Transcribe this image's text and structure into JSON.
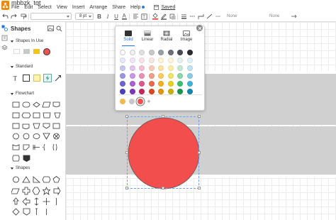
{
  "titlebar": {
    "title": "mbbzk_tgt"
  },
  "menu": {
    "items": [
      "File",
      "Edit",
      "Select",
      "View",
      "Insert",
      "Arrange",
      "Share",
      "Help"
    ],
    "saved_label": "Saved"
  },
  "toolbar": {
    "font_size": "8 pt",
    "line_none_left": "None",
    "line_none_right": "None"
  },
  "sidebar": {
    "header": "Shapes",
    "sections": [
      "Shapes In Use",
      "Standard",
      "Flowchart",
      "Shapes"
    ],
    "in_use_colors": [
      "#ffffff",
      "#c9c9c9",
      "#f0c419",
      "#f05050"
    ]
  },
  "picker": {
    "tabs": [
      "Solid",
      "Linear",
      "Radial",
      "Image"
    ],
    "active_tab": "Solid",
    "palette_rows": [
      [
        "#ffffff",
        "#f2f2f2",
        "#e0e0e0",
        "#c8c8c8",
        "#9aa0a6",
        "#6b7079",
        "#464b55",
        "#2a2d33"
      ],
      [
        "#e8e7f6",
        "#f1e6f5",
        "#f9e2ea",
        "#fbe7e1",
        "#fff4d6",
        "#fcf8d9",
        "#e3f4ea",
        "#e0f1f5"
      ],
      [
        "#c9c6ee",
        "#e3c6ee",
        "#f3c1d4",
        "#f9cbbd",
        "#ffe3a6",
        "#f9f0a3",
        "#c3ead0",
        "#bde4ef"
      ],
      [
        "#9c95e4",
        "#c896e4",
        "#ec8fb4",
        "#f29e87",
        "#ffcb5f",
        "#f3e45f",
        "#88d8a6",
        "#86cde4"
      ],
      [
        "#6d62d6",
        "#a960d4",
        "#e0568d",
        "#ea6a4a",
        "#f5b020",
        "#e9d21d",
        "#3bbf6e",
        "#42b2d9"
      ],
      [
        "#4a3fbf",
        "#8234b8",
        "#c8245c",
        "#d94725",
        "#e59109",
        "#c9b103",
        "#16974b",
        "#1487b3"
      ]
    ],
    "recent": [
      "#f5b84a",
      "#c8c8c8",
      "#f05050"
    ]
  },
  "canvas": {
    "circle_fill": "#f24e4e",
    "road_color": "#d0d0d0"
  }
}
